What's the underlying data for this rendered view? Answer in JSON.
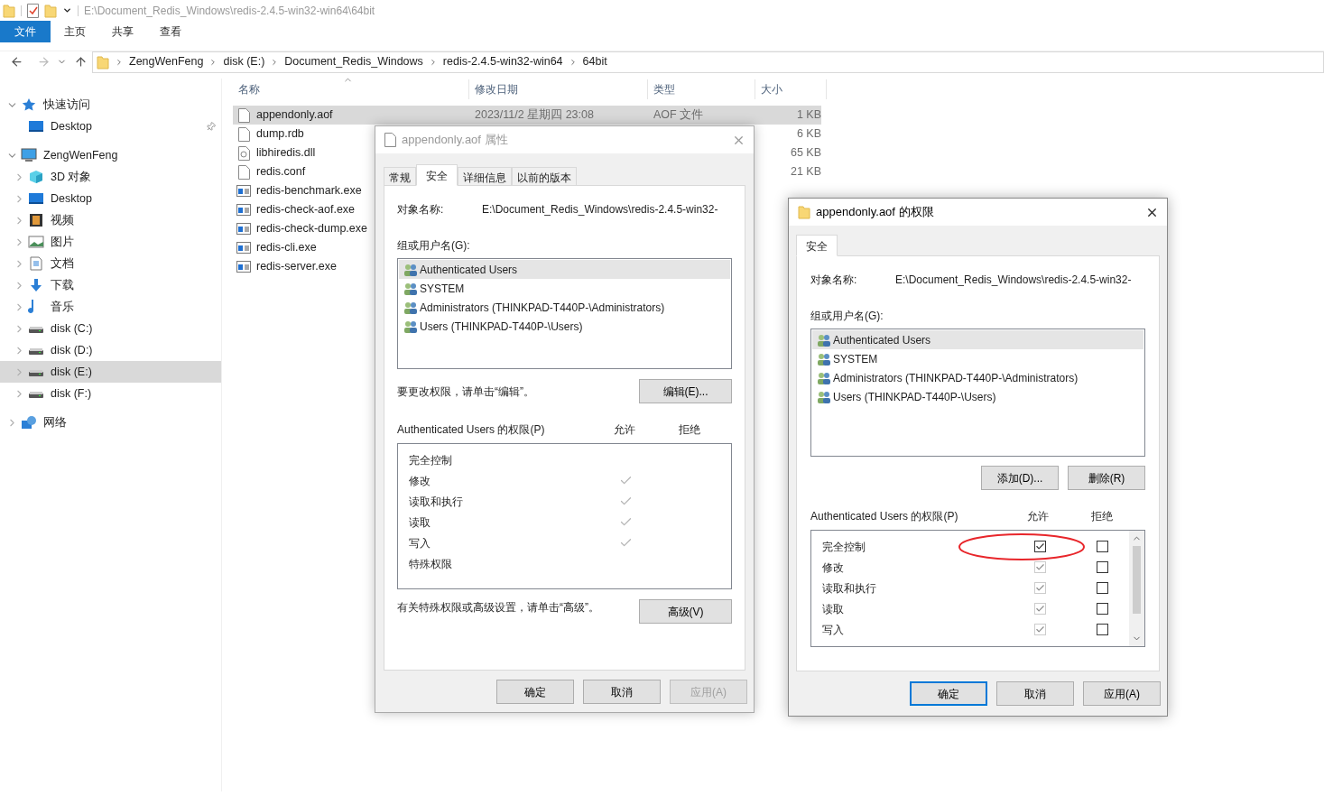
{
  "title_bar": {
    "path": "E:\\Document_Redis_Windows\\redis-2.4.5-win32-win64\\64bit"
  },
  "ribbon_tabs": [
    {
      "label": "文件",
      "selected": true
    },
    {
      "label": "主页",
      "selected": false
    },
    {
      "label": "共享",
      "selected": false
    },
    {
      "label": "查看",
      "selected": false
    }
  ],
  "breadcrumb": [
    "ZengWenFeng",
    "disk (E:)",
    "Document_Redis_Windows",
    "redis-2.4.5-win32-win64",
    "64bit"
  ],
  "sidebar": {
    "items": [
      {
        "label": "快速访问",
        "kind": "star",
        "expanded": true,
        "selected": false,
        "children": [
          {
            "label": "Desktop",
            "kind": "desktop",
            "pinned": true,
            "selected": false
          }
        ]
      },
      {
        "label": "ZengWenFeng",
        "kind": "computer",
        "expanded": true,
        "selected": false,
        "children": [
          {
            "label": "3D 对象",
            "kind": "cube",
            "expanded": false,
            "selected": false
          },
          {
            "label": "Desktop",
            "kind": "desktop",
            "expanded": false,
            "selected": false
          },
          {
            "label": "视频",
            "kind": "film",
            "expanded": false,
            "selected": false
          },
          {
            "label": "图片",
            "kind": "picture",
            "expanded": false,
            "selected": false
          },
          {
            "label": "文档",
            "kind": "document",
            "expanded": false,
            "selected": false
          },
          {
            "label": "下载",
            "kind": "download",
            "expanded": false,
            "selected": false
          },
          {
            "label": "音乐",
            "kind": "music",
            "expanded": false,
            "selected": false
          },
          {
            "label": "disk (C:)",
            "kind": "drive",
            "expanded": false,
            "selected": false
          },
          {
            "label": "disk (D:)",
            "kind": "drive",
            "expanded": false,
            "selected": false
          },
          {
            "label": "disk (E:)",
            "kind": "drive",
            "expanded": false,
            "selected": true
          },
          {
            "label": "disk (F:)",
            "kind": "drive",
            "expanded": false,
            "selected": false
          }
        ]
      },
      {
        "label": "网络",
        "kind": "network",
        "expanded": false,
        "selected": false
      }
    ]
  },
  "file_list": {
    "columns": [
      "名称",
      "修改日期",
      "类型",
      "大小"
    ],
    "rows": [
      {
        "name": "appendonly.aof",
        "kind": "file",
        "modified": "2023/11/2 星期四 23:08",
        "type": "AOF 文件",
        "size": "1 KB",
        "selected": true
      },
      {
        "name": "dump.rdb",
        "kind": "file",
        "size": "6 KB",
        "selected": false
      },
      {
        "name": "libhiredis.dll",
        "kind": "dll",
        "size": "65 KB",
        "selected": false
      },
      {
        "name": "redis.conf",
        "kind": "file",
        "size": "21 KB",
        "selected": false
      },
      {
        "name": "redis-benchmark.exe",
        "kind": "exe",
        "selected": false
      },
      {
        "name": "redis-check-aof.exe",
        "kind": "exe",
        "selected": false
      },
      {
        "name": "redis-check-dump.exe",
        "kind": "exe",
        "selected": false
      },
      {
        "name": "redis-cli.exe",
        "kind": "exe",
        "selected": false
      },
      {
        "name": "redis-server.exe",
        "kind": "exe",
        "selected": false
      }
    ]
  },
  "properties_dialog": {
    "title": "appendonly.aof 属性",
    "tabs": [
      {
        "label": "常规",
        "selected": false
      },
      {
        "label": "安全",
        "selected": true
      },
      {
        "label": "详细信息",
        "selected": false
      },
      {
        "label": "以前的版本",
        "selected": false
      }
    ],
    "object_label": "对象名称:",
    "object_value": "E:\\Document_Redis_Windows\\redis-2.4.5-win32-",
    "groups_label": "组或用户名(G):",
    "groups": [
      {
        "name": "Authenticated Users",
        "selected": true
      },
      {
        "name": "SYSTEM",
        "selected": false
      },
      {
        "name": "Administrators (THINKPAD-T440P-\\Administrators)",
        "selected": false
      },
      {
        "name": "Users (THINKPAD-T440P-\\Users)",
        "selected": false
      }
    ],
    "edit_hint": "要更改权限，请单击“编辑”。",
    "edit_button": "编辑(E)...",
    "permissions_label": "Authenticated Users 的权限(P)",
    "allow_header": "允许",
    "deny_header": "拒绝",
    "permissions": [
      {
        "label": "完全控制",
        "allow": false
      },
      {
        "label": "修改",
        "allow": true
      },
      {
        "label": "读取和执行",
        "allow": true
      },
      {
        "label": "读取",
        "allow": true
      },
      {
        "label": "写入",
        "allow": true
      },
      {
        "label": "特殊权限",
        "allow": false
      }
    ],
    "advanced_hint": "有关特殊权限或高级设置，请单击“高级”。",
    "advanced_button": "高级(V)",
    "buttons": [
      {
        "label": "确定",
        "disabled": false
      },
      {
        "label": "取消",
        "disabled": false
      },
      {
        "label": "应用(A)",
        "disabled": true
      }
    ]
  },
  "permissions_dialog": {
    "title": "appendonly.aof 的权限",
    "tabs": [
      {
        "label": "安全",
        "selected": true
      }
    ],
    "object_label": "对象名称:",
    "object_value": "E:\\Document_Redis_Windows\\redis-2.4.5-win32-",
    "groups_label": "组或用户名(G):",
    "groups": [
      {
        "name": "Authenticated Users",
        "selected": true
      },
      {
        "name": "SYSTEM",
        "selected": false
      },
      {
        "name": "Administrators (THINKPAD-T440P-\\Administrators)",
        "selected": false
      },
      {
        "name": "Users (THINKPAD-T440P-\\Users)",
        "selected": false
      }
    ],
    "add_button": "添加(D)...",
    "remove_button": "删除(R)",
    "permissions_label": "Authenticated Users 的权限(P)",
    "allow_header": "允许",
    "deny_header": "拒绝",
    "permissions": [
      {
        "label": "完全控制",
        "allow": true,
        "deny": false,
        "disabled": false,
        "highlighted": true
      },
      {
        "label": "修改",
        "allow": true,
        "deny": false,
        "disabled": true,
        "highlighted": false
      },
      {
        "label": "读取和执行",
        "allow": true,
        "deny": false,
        "disabled": true,
        "highlighted": false
      },
      {
        "label": "读取",
        "allow": true,
        "deny": false,
        "disabled": true,
        "highlighted": false
      },
      {
        "label": "写入",
        "allow": true,
        "deny": false,
        "disabled": true,
        "highlighted": false
      }
    ],
    "buttons": [
      {
        "label": "确定",
        "default": true
      },
      {
        "label": "取消",
        "default": false
      },
      {
        "label": "应用(A)",
        "default": false
      }
    ]
  }
}
